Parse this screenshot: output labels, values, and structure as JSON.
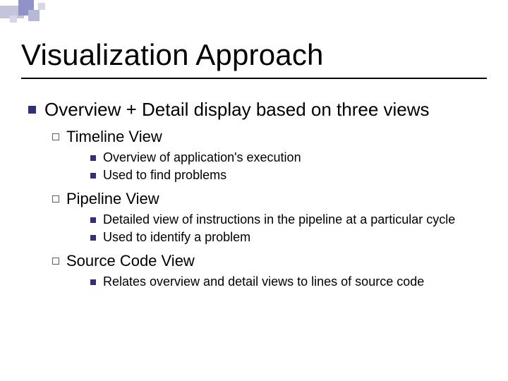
{
  "title": "Visualization Approach",
  "bullets": {
    "l1": {
      "text": "Overview + Detail display based on three views",
      "children": [
        {
          "text": "Timeline View",
          "children": [
            {
              "text": "Overview of application's execution"
            },
            {
              "text": "Used to find problems"
            }
          ]
        },
        {
          "text": "Pipeline View",
          "children": [
            {
              "text": "Detailed view of instructions in the pipeline at a particular cycle"
            },
            {
              "text": "Used to identify a problem"
            }
          ]
        },
        {
          "text": "Source Code View",
          "children": [
            {
              "text": "Relates overview and detail views to lines of source code"
            }
          ]
        }
      ]
    }
  }
}
